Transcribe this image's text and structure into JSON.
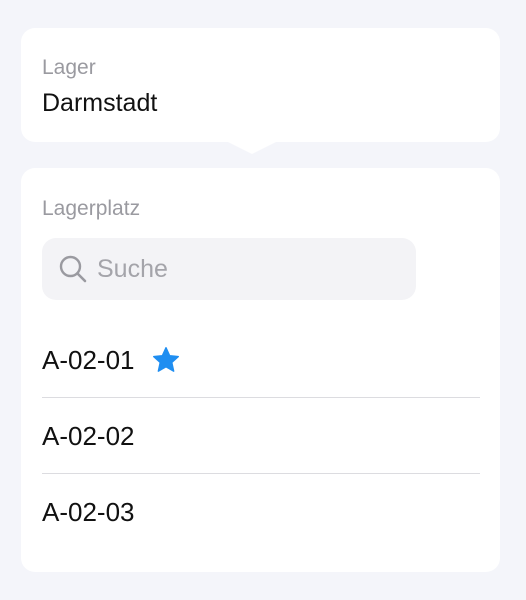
{
  "lager": {
    "label": "Lager",
    "value": "Darmstadt"
  },
  "lagerplatz": {
    "label": "Lagerplatz",
    "search": {
      "placeholder": "Suche",
      "icon": "search-icon"
    },
    "items": [
      {
        "label": "A-02-01",
        "favorite": true,
        "icon": "star-icon"
      },
      {
        "label": "A-02-02",
        "favorite": false
      },
      {
        "label": "A-02-03",
        "favorite": false
      }
    ]
  },
  "colors": {
    "background": "#f4f5fa",
    "card": "#ffffff",
    "accent_star": "#1f8ef1",
    "label_gray": "#9a9aa0",
    "search_bg": "#f3f3f6",
    "divider": "#dcdce0"
  }
}
